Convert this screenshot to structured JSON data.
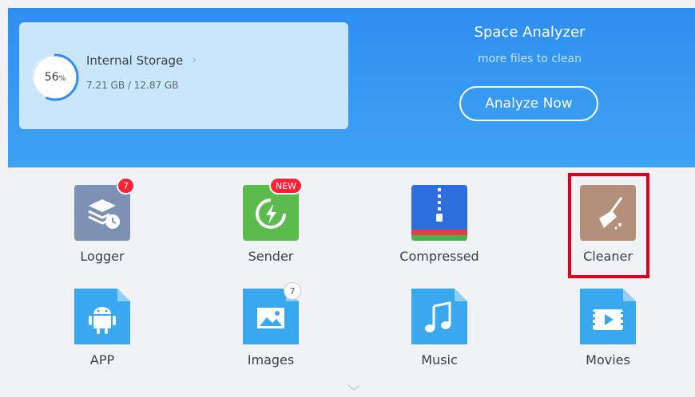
{
  "storage": {
    "label": "Internal Storage",
    "used_text": "7.21 GB / 12.87 GB",
    "percent_value": "56",
    "percent_sign": "%",
    "fraction": 0.56
  },
  "space_analyzer": {
    "title": "Space Analyzer",
    "subtitle": "more files to clean",
    "button": "Analyze Now"
  },
  "grid": {
    "logger": {
      "label": "Logger",
      "badge": "7"
    },
    "sender": {
      "label": "Sender",
      "badge": "NEW"
    },
    "compressed": {
      "label": "Compressed"
    },
    "cleaner": {
      "label": "Cleaner"
    },
    "app": {
      "label": "APP"
    },
    "images": {
      "label": "Images",
      "badge": "7"
    },
    "music": {
      "label": "Music"
    },
    "movies": {
      "label": "Movies"
    }
  },
  "colors": {
    "header": "#3498f2",
    "accent_ring": "#2f8ef0",
    "logger": "#7d91b4",
    "sender": "#5cbb4d",
    "compressed": "#2d6fdd",
    "cleaner": "#b48f79",
    "file_blue": "#3aa8ee",
    "badge": "#ff2236",
    "highlight": "#e2001a"
  },
  "icons": {
    "logger": "layers-clock-icon",
    "sender": "lightning-refresh-icon",
    "compressed": "zip-icon",
    "cleaner": "broom-icon",
    "app": "android-icon",
    "images": "image-icon",
    "music": "music-note-icon",
    "movies": "play-icon"
  }
}
